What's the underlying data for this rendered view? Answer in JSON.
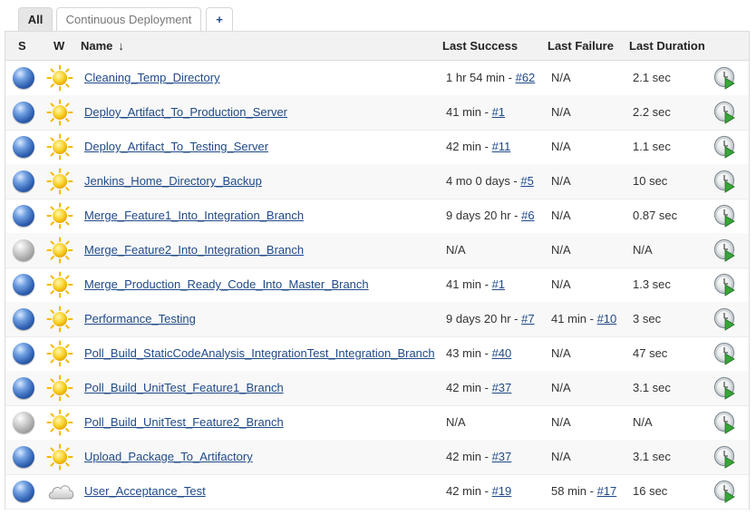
{
  "tabs": [
    {
      "label": "All",
      "active": true
    },
    {
      "label": "Continuous Deployment",
      "active": false
    },
    {
      "label": "+",
      "active": false
    }
  ],
  "columns": {
    "status": "S",
    "weather": "W",
    "name": "Name",
    "sort_indicator": "↓",
    "last_success": "Last Success",
    "last_failure": "Last Failure",
    "last_duration": "Last Duration"
  },
  "icons": {
    "status_success": "blue-ball-icon",
    "status_notbuilt": "grey-ball-icon",
    "weather_sunny": "sun-icon",
    "weather_cloudy": "cloud-icon",
    "schedule": "schedule-build-icon"
  },
  "colors": {
    "link": "#204a87",
    "header_bg": "#f2f2f2",
    "status_blue": "#2f5fb0",
    "status_grey": "#9a9a9a",
    "sun": "#f5c518"
  },
  "jobs": [
    {
      "status": "blue",
      "weather": "sunny",
      "name": "Cleaning_Temp_Directory",
      "last_success": "1 hr 54 min - ",
      "last_success_build": "#62",
      "last_failure": "N/A",
      "last_failure_build": "",
      "last_duration": "2.1 sec"
    },
    {
      "status": "blue",
      "weather": "sunny",
      "name": "Deploy_Artifact_To_Production_Server",
      "last_success": "41 min - ",
      "last_success_build": "#1",
      "last_failure": "N/A",
      "last_failure_build": "",
      "last_duration": "2.2 sec"
    },
    {
      "status": "blue",
      "weather": "sunny",
      "name": "Deploy_Artifact_To_Testing_Server",
      "last_success": "42 min - ",
      "last_success_build": "#11",
      "last_failure": "N/A",
      "last_failure_build": "",
      "last_duration": "1.1 sec"
    },
    {
      "status": "blue",
      "weather": "sunny",
      "name": "Jenkins_Home_Directory_Backup",
      "last_success": "4 mo 0 days - ",
      "last_success_build": "#5",
      "last_failure": "N/A",
      "last_failure_build": "",
      "last_duration": "10 sec"
    },
    {
      "status": "blue",
      "weather": "sunny",
      "name": "Merge_Feature1_Into_Integration_Branch",
      "last_success": "9 days 20 hr - ",
      "last_success_build": "#6",
      "last_failure": "N/A",
      "last_failure_build": "",
      "last_duration": "0.87 sec"
    },
    {
      "status": "grey",
      "weather": "sunny",
      "name": "Merge_Feature2_Into_Integration_Branch",
      "last_success": "N/A",
      "last_success_build": "",
      "last_failure": "N/A",
      "last_failure_build": "",
      "last_duration": "N/A"
    },
    {
      "status": "blue",
      "weather": "sunny",
      "name": "Merge_Production_Ready_Code_Into_Master_Branch",
      "last_success": "41 min - ",
      "last_success_build": "#1",
      "last_failure": "N/A",
      "last_failure_build": "",
      "last_duration": "1.3 sec"
    },
    {
      "status": "blue",
      "weather": "sunny",
      "name": "Performance_Testing",
      "last_success": "9 days 20 hr - ",
      "last_success_build": "#7",
      "last_failure": "41 min - ",
      "last_failure_build": "#10",
      "last_duration": "3 sec"
    },
    {
      "status": "blue",
      "weather": "sunny",
      "name": "Poll_Build_StaticCodeAnalysis_IntegrationTest_Integration_Branch",
      "last_success": "43 min - ",
      "last_success_build": "#40",
      "last_failure": "N/A",
      "last_failure_build": "",
      "last_duration": "47 sec"
    },
    {
      "status": "blue",
      "weather": "sunny",
      "name": "Poll_Build_UnitTest_Feature1_Branch",
      "last_success": "42 min - ",
      "last_success_build": "#37",
      "last_failure": "N/A",
      "last_failure_build": "",
      "last_duration": "3.1 sec"
    },
    {
      "status": "grey",
      "weather": "sunny",
      "name": "Poll_Build_UnitTest_Feature2_Branch",
      "last_success": "N/A",
      "last_success_build": "",
      "last_failure": "N/A",
      "last_failure_build": "",
      "last_duration": "N/A"
    },
    {
      "status": "blue",
      "weather": "sunny",
      "name": "Upload_Package_To_Artifactory",
      "last_success": "42 min - ",
      "last_success_build": "#37",
      "last_failure": "N/A",
      "last_failure_build": "",
      "last_duration": "3.1 sec"
    },
    {
      "status": "blue",
      "weather": "cloudy",
      "name": "User_Acceptance_Test",
      "last_success": "42 min - ",
      "last_success_build": "#19",
      "last_failure": "58 min - ",
      "last_failure_build": "#17",
      "last_duration": "16 sec"
    }
  ]
}
